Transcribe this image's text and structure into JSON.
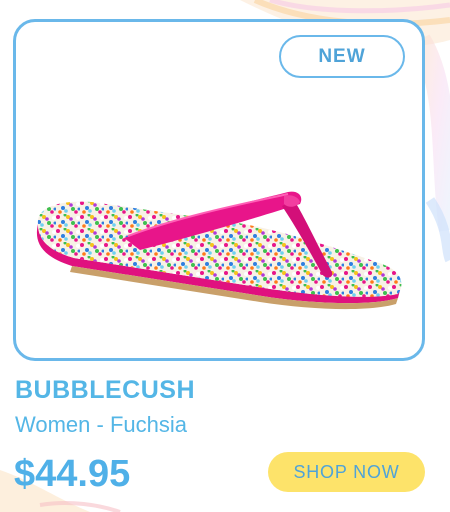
{
  "product": {
    "badge": "NEW",
    "brand": "BUBBLECUSH",
    "subtitle": "Women - Fuchsia",
    "price": "$44.95",
    "shop_button_label": "SHOP NOW",
    "image_icon": "flip-flop-sandal-image"
  },
  "colors": {
    "accent_blue": "#6ab8ea",
    "text_blue": "#54b6e6",
    "button_yellow": "#fde36a",
    "strap_fuchsia": "#e8158a"
  }
}
